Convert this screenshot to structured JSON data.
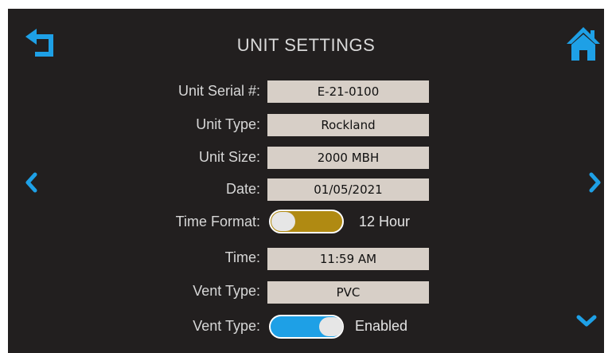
{
  "header": {
    "title": "UNIT SETTINGS",
    "back_icon": "back-arrow-icon",
    "home_icon": "home-icon"
  },
  "nav": {
    "prev_icon": "chevron-left-icon",
    "next_icon": "chevron-right-icon",
    "down_icon": "chevron-down-icon"
  },
  "settings": {
    "serial": {
      "label": "Unit Serial #:",
      "value": "E-21-0100"
    },
    "type": {
      "label": "Unit Type:",
      "value": "Rockland"
    },
    "size": {
      "label": "Unit Size:",
      "value": "2000 MBH"
    },
    "date": {
      "label": "Date:",
      "value": "01/05/2021"
    },
    "time_format": {
      "label": "Time Format:",
      "value": "12 Hour",
      "state": "on"
    },
    "time": {
      "label": "Time:",
      "value": "11:59 AM"
    },
    "vent_type": {
      "label": "Vent Type:",
      "value": "PVC"
    },
    "vent_toggle": {
      "label": "Vent Type:",
      "value": "Enabled",
      "state": "on"
    }
  },
  "colors": {
    "background": "#221f1f",
    "accent_blue": "#1ea0e6",
    "time_format_toggle": "#b08a12",
    "vent_toggle": "#1ea0e6",
    "field_bg": "#d7cfc7"
  }
}
